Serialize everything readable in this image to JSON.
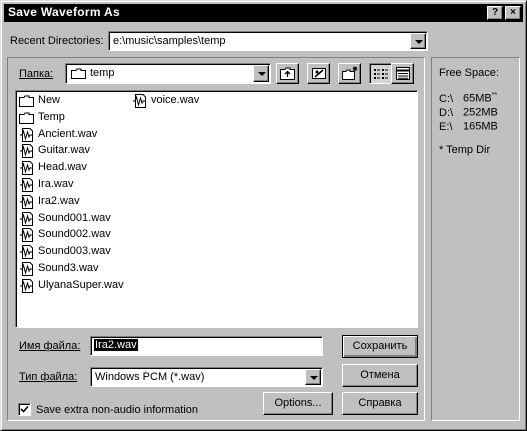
{
  "window": {
    "title": "Save Waveform As",
    "help_glyph": "?",
    "close_glyph": "×"
  },
  "recent": {
    "label": "Recent Directories:",
    "value": "e:\\music\\samples\\temp"
  },
  "folder": {
    "label": "Папка:",
    "value": "temp"
  },
  "files": {
    "column1": [
      {
        "name": "New",
        "type": "folder"
      },
      {
        "name": "Temp",
        "type": "folder"
      },
      {
        "name": "Ancient.wav",
        "type": "wav"
      },
      {
        "name": "Guitar.wav",
        "type": "wav"
      },
      {
        "name": "Head.wav",
        "type": "wav"
      },
      {
        "name": "Ira.wav",
        "type": "wav"
      },
      {
        "name": "Ira2.wav",
        "type": "wav"
      },
      {
        "name": "Sound001.wav",
        "type": "wav"
      },
      {
        "name": "Sound002.wav",
        "type": "wav"
      },
      {
        "name": "Sound003.wav",
        "type": "wav"
      },
      {
        "name": "Sound3.wav",
        "type": "wav"
      },
      {
        "name": "UlyanaSuper.wav",
        "type": "wav"
      }
    ],
    "column2": [
      {
        "name": "voice.wav",
        "type": "wav"
      }
    ]
  },
  "filename": {
    "label": "Имя файла:",
    "value": "Ira2.wav"
  },
  "filetype": {
    "label": "Тип файла:",
    "value": "Windows PCM (*.wav)"
  },
  "options": {
    "extra_info_label": "Save extra non-audio information",
    "extra_info_checked": true
  },
  "buttons": {
    "save": "Сохранить",
    "cancel": "Отмена",
    "help": "Справка",
    "options": "Options..."
  },
  "free_space": {
    "title": "Free Space:",
    "drives": [
      {
        "drive": "C:\\",
        "size": "65MB",
        "mark": "**"
      },
      {
        "drive": "D:\\",
        "size": "252MB",
        "mark": ""
      },
      {
        "drive": "E:\\",
        "size": "165MB",
        "mark": ""
      }
    ],
    "note": "* Temp Dir"
  },
  "icons": {
    "up_folder": "up-one-level-icon",
    "desktop": "desktop-icon",
    "new_folder": "new-folder-icon",
    "list_view": "list-view-icon",
    "details_view": "details-view-icon"
  }
}
